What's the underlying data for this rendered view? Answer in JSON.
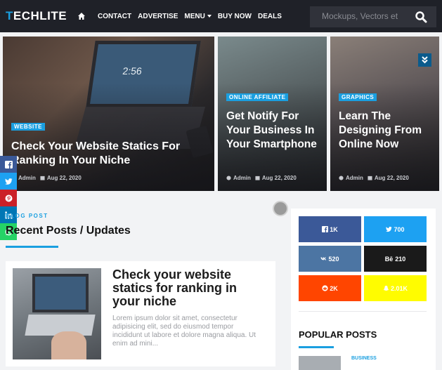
{
  "brand": {
    "logo_first": "T",
    "logo_rest": "ECHLITE"
  },
  "nav": {
    "items": [
      {
        "label": "CONTACT"
      },
      {
        "label": "ADVERTISE"
      },
      {
        "label": "MENU"
      },
      {
        "label": "BUY NOW"
      },
      {
        "label": "DEALS"
      }
    ]
  },
  "search": {
    "placeholder": "Mockups, Vectors et"
  },
  "featured": [
    {
      "category": "WEBSITE",
      "title": "Check Your Website Statics For Ranking In Your Niche",
      "author": "Admin",
      "date": "Aug 22, 2020",
      "screen_time": "2:56"
    },
    {
      "category": "ONLINE AFFILIATE",
      "title": "Get Notify For Your Business In Your Smartphone",
      "author": "Admin",
      "date": "Aug 22, 2020"
    },
    {
      "category": "GRAPHICS",
      "title": "Learn The Designing From Online Now",
      "author": "Admin",
      "date": "Aug 22, 2020"
    }
  ],
  "share_bar": [
    "facebook",
    "twitter",
    "pinterest",
    "linkedin",
    "whatsapp"
  ],
  "recent": {
    "kicker": "BLOG POST",
    "title": "Recent Posts / Updates",
    "post": {
      "title": "Check your website statics for ranking in your niche",
      "excerpt": "Lorem ipsum dolor sit amet, consectetur adipisicing elit, sed do eiusmod tempor incididunt ut labore et dolore magna aliqua. Ut enim ad mini..."
    }
  },
  "social_counts": [
    {
      "network": "facebook",
      "count": "1K",
      "color": "#3b5998"
    },
    {
      "network": "twitter",
      "count": "700",
      "color": "#1da1f2"
    },
    {
      "network": "vk",
      "count": "520",
      "color": "#4c75a3"
    },
    {
      "network": "behance",
      "count": "210",
      "color": "#1a1a1a",
      "icon_text": "Bē"
    },
    {
      "network": "reddit",
      "count": "2K",
      "color": "#ff4500"
    },
    {
      "network": "snapchat",
      "count": "2.01K",
      "color": "#fffc00"
    }
  ],
  "popular": {
    "title": "POPULAR POSTS",
    "tag": "BUSINESS"
  }
}
